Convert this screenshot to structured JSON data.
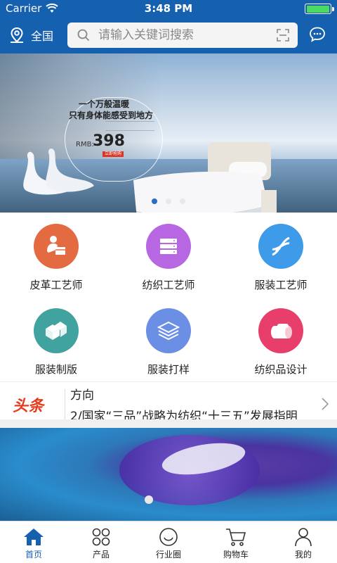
{
  "status_bar": {
    "carrier": "Carrier",
    "time": "3:48 PM",
    "battery_level": 1.0
  },
  "nav": {
    "location": "全国",
    "search_placeholder": "请输入关键词搜索"
  },
  "banner": {
    "line1": "一个万般温暖",
    "line2": "只有身体能感受到地方",
    "price_label": "RMB:",
    "price": "398",
    "buy": "立即抢购",
    "pages": 3,
    "active_page": 1
  },
  "categories": [
    {
      "label": "皮革工艺师",
      "icon": "leather-craftsman-icon",
      "color": "#e46a42"
    },
    {
      "label": "纺织工艺师",
      "icon": "textile-craftsman-icon",
      "color": "#b767e2"
    },
    {
      "label": "服装工艺师",
      "icon": "garment-craftsman-icon",
      "color": "#3d9be9"
    },
    {
      "label": "服装制版",
      "icon": "garment-pattern-icon",
      "color": "#41a3a0"
    },
    {
      "label": "服装打样",
      "icon": "garment-sample-icon",
      "color": "#6b8fe5"
    },
    {
      "label": "纺织品设计",
      "icon": "textile-design-icon",
      "color": "#e73e6b"
    }
  ],
  "headline": {
    "tag": "头条",
    "line1": "方向",
    "line2": "2/国家“三品”战略为纺织“十三五”发展指明"
  },
  "tabs": [
    {
      "label": "首页",
      "icon": "home-icon",
      "active": true
    },
    {
      "label": "产品",
      "icon": "products-icon",
      "active": false
    },
    {
      "label": "行业圈",
      "icon": "industry-circle-icon",
      "active": false
    },
    {
      "label": "购物车",
      "icon": "cart-icon",
      "active": false
    },
    {
      "label": "我的",
      "icon": "profile-icon",
      "active": false
    }
  ],
  "colors": {
    "primary": "#1660b0",
    "headline_tag": "#e8391d"
  }
}
